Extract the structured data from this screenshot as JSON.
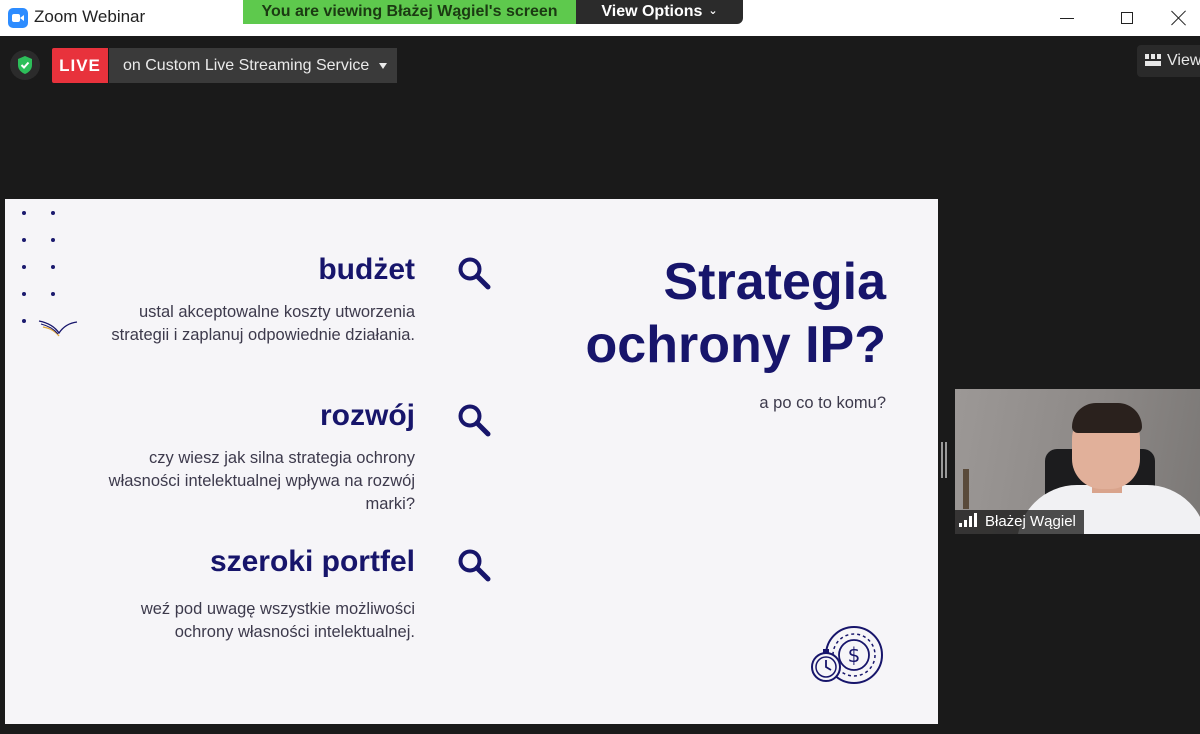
{
  "window": {
    "title": "Zoom Webinar",
    "share_banner": "You are viewing Błażej Wągiel's screen",
    "view_options_label": "View Options"
  },
  "toolbar": {
    "live_label": "LIVE",
    "stream_label": "on Custom Live Streaming Service",
    "view_label": "View"
  },
  "slide": {
    "sections": [
      {
        "heading": "budżet",
        "text": "ustal akceptowalne koszty utworzenia strategii i zaplanuj odpowiednie działania."
      },
      {
        "heading": "rozwój",
        "text": "czy wiesz jak silna strategia ochrony własności intelektualnej wpływa na rozwój marki?"
      },
      {
        "heading": "szeroki portfel",
        "text": "weź pod uwagę wszystkie możliwości ochrony własności intelektualnej."
      }
    ],
    "title_line1": "Strategia",
    "title_line2": "ochrony IP?",
    "subtitle": "a po co to komu?",
    "accent_color": "#17156b"
  },
  "participant": {
    "name": "Błażej Wągiel"
  },
  "colors": {
    "live_red": "#e8323c",
    "banner_green": "#5ec94d",
    "shield_green": "#2dbf5a"
  }
}
